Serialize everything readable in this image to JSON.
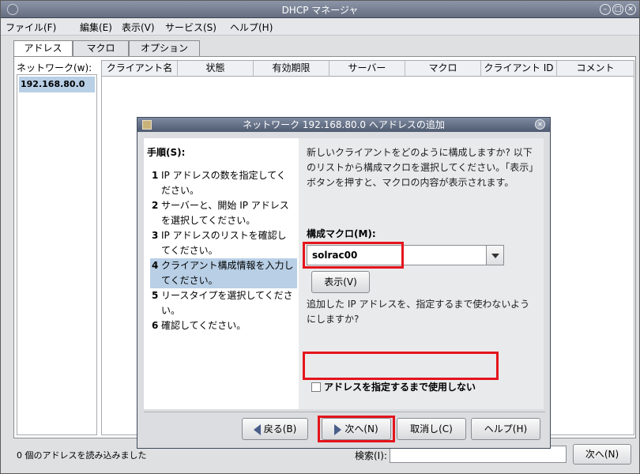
{
  "window": {
    "title": "DHCP マネージャ"
  },
  "menu": [
    "ファイル(F)",
    "編集(E)",
    "表示(V)",
    "サービス(S)",
    "ヘルプ(H)"
  ],
  "tabs": [
    "アドレス",
    "マクロ",
    "オプション"
  ],
  "network": {
    "label": "ネットワーク(w):",
    "items": [
      "192.168.80.0"
    ]
  },
  "table": {
    "columns": [
      "クライアント名",
      "状態",
      "有効期限",
      "サーバー",
      "マクロ",
      "クライアント ID",
      "コメント"
    ]
  },
  "statusbar": {
    "message": "0 個のアドレスを読み込みました",
    "search_label": "検索(I):",
    "search_value": "",
    "next_label": "次へ(N)"
  },
  "dialog": {
    "title": "ネットワーク 192.168.80.0 へアドレスの追加",
    "steps_header": "手順(S):",
    "steps": [
      {
        "num": "1",
        "text": "IP アドレスの数を指定してください。"
      },
      {
        "num": "2",
        "text": "サーバーと、開始 IP アドレスを選択してください。"
      },
      {
        "num": "3",
        "text": "IP アドレスのリストを確認してください。"
      },
      {
        "num": "4",
        "text": "クライアント構成情報を入力してください。"
      },
      {
        "num": "5",
        "text": "リースタイプを選択してください。"
      },
      {
        "num": "6",
        "text": "確認してください。"
      }
    ],
    "current_step": 4,
    "description": "新しいクライアントをどのように構成しますか? 以下のリストから構成マクロを選択してください。「表示」ボタンを押すと、マクロの内容が表示されます。",
    "macro_label": "構成マクロ(M):",
    "macro_value": "solrac00",
    "view_button": "表示(V)",
    "reserve_question": "追加した IP アドレスを、指定するまで使わないようにしますか?",
    "reserve_checkbox_label": "アドレスを指定するまで使用しない",
    "reserve_checked": false,
    "buttons": {
      "back": "戻る(B)",
      "next": "次へ(N)",
      "cancel": "取消し(C)",
      "help": "ヘルプ(H)"
    }
  },
  "colors": {
    "highlight_box": "#e4141c",
    "selection": "#b8cfe6",
    "titlebar": "#656e80"
  }
}
